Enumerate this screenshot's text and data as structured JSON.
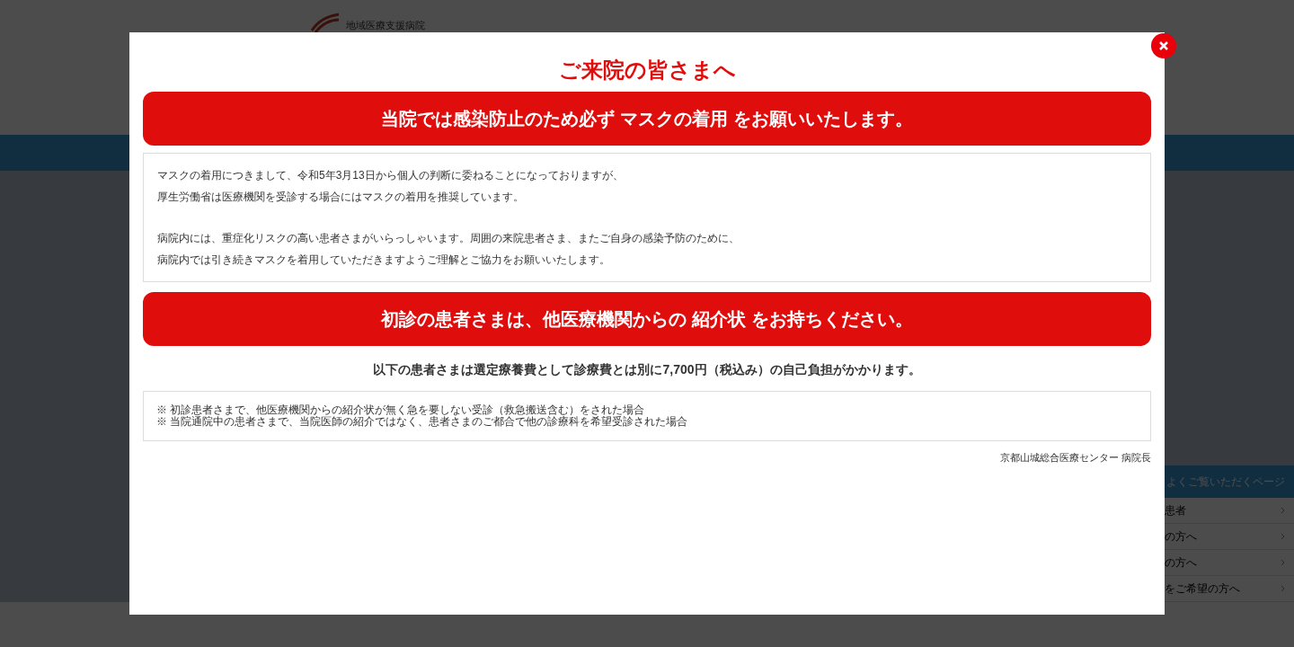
{
  "background_page": {
    "header": {
      "tagline": "地域医療支援病院"
    },
    "sidebar": {
      "heading": "よくご覧いただくページ",
      "items": [
        "患者",
        "の方へ",
        "の方へ",
        "をご希望の方へ"
      ]
    }
  },
  "modal": {
    "title": "ご来院の皆さまへ",
    "sections": [
      {
        "kind": "banner",
        "text": "当院では感染防止のため必ず マスクの着用 をお願いいたします。"
      },
      {
        "kind": "textbox",
        "paragraphs": [
          [
            "マスクの着用につきまして、令和5年3月13日から個人の判断に委ねることになっておりますが、",
            "厚生労働省は医療機関を受診する場合にはマスクの着用を推奨しています。"
          ],
          [
            "病院内には、重症化リスクの高い患者さまがいらっしゃいます。周囲の来院患者さま、またご自身の感染予防のために、",
            "病院内では引き続きマスクを着用していただきますようご理解とご協力をお願いいたします。"
          ]
        ]
      },
      {
        "kind": "banner",
        "text": "初診の患者さまは、他医療機関からの 紹介状 をお持ちください。"
      },
      {
        "kind": "lead",
        "text": "以下の患者さまは選定療養費として診療費とは別に7,700円（税込み）の自己負担がかかります。"
      },
      {
        "kind": "notes",
        "items": [
          "※ 初診患者さまで、他医療機関からの紹介状が無く急を要しない受診（救急搬送含む）をされた場合",
          "※ 当院通院中の患者さまで、当院医師の紹介ではなく、患者さまのご都合で他の診療科を希望受診された場合"
        ]
      },
      {
        "kind": "signature",
        "text": "京都山城総合医療センター 病院長"
      }
    ]
  }
}
